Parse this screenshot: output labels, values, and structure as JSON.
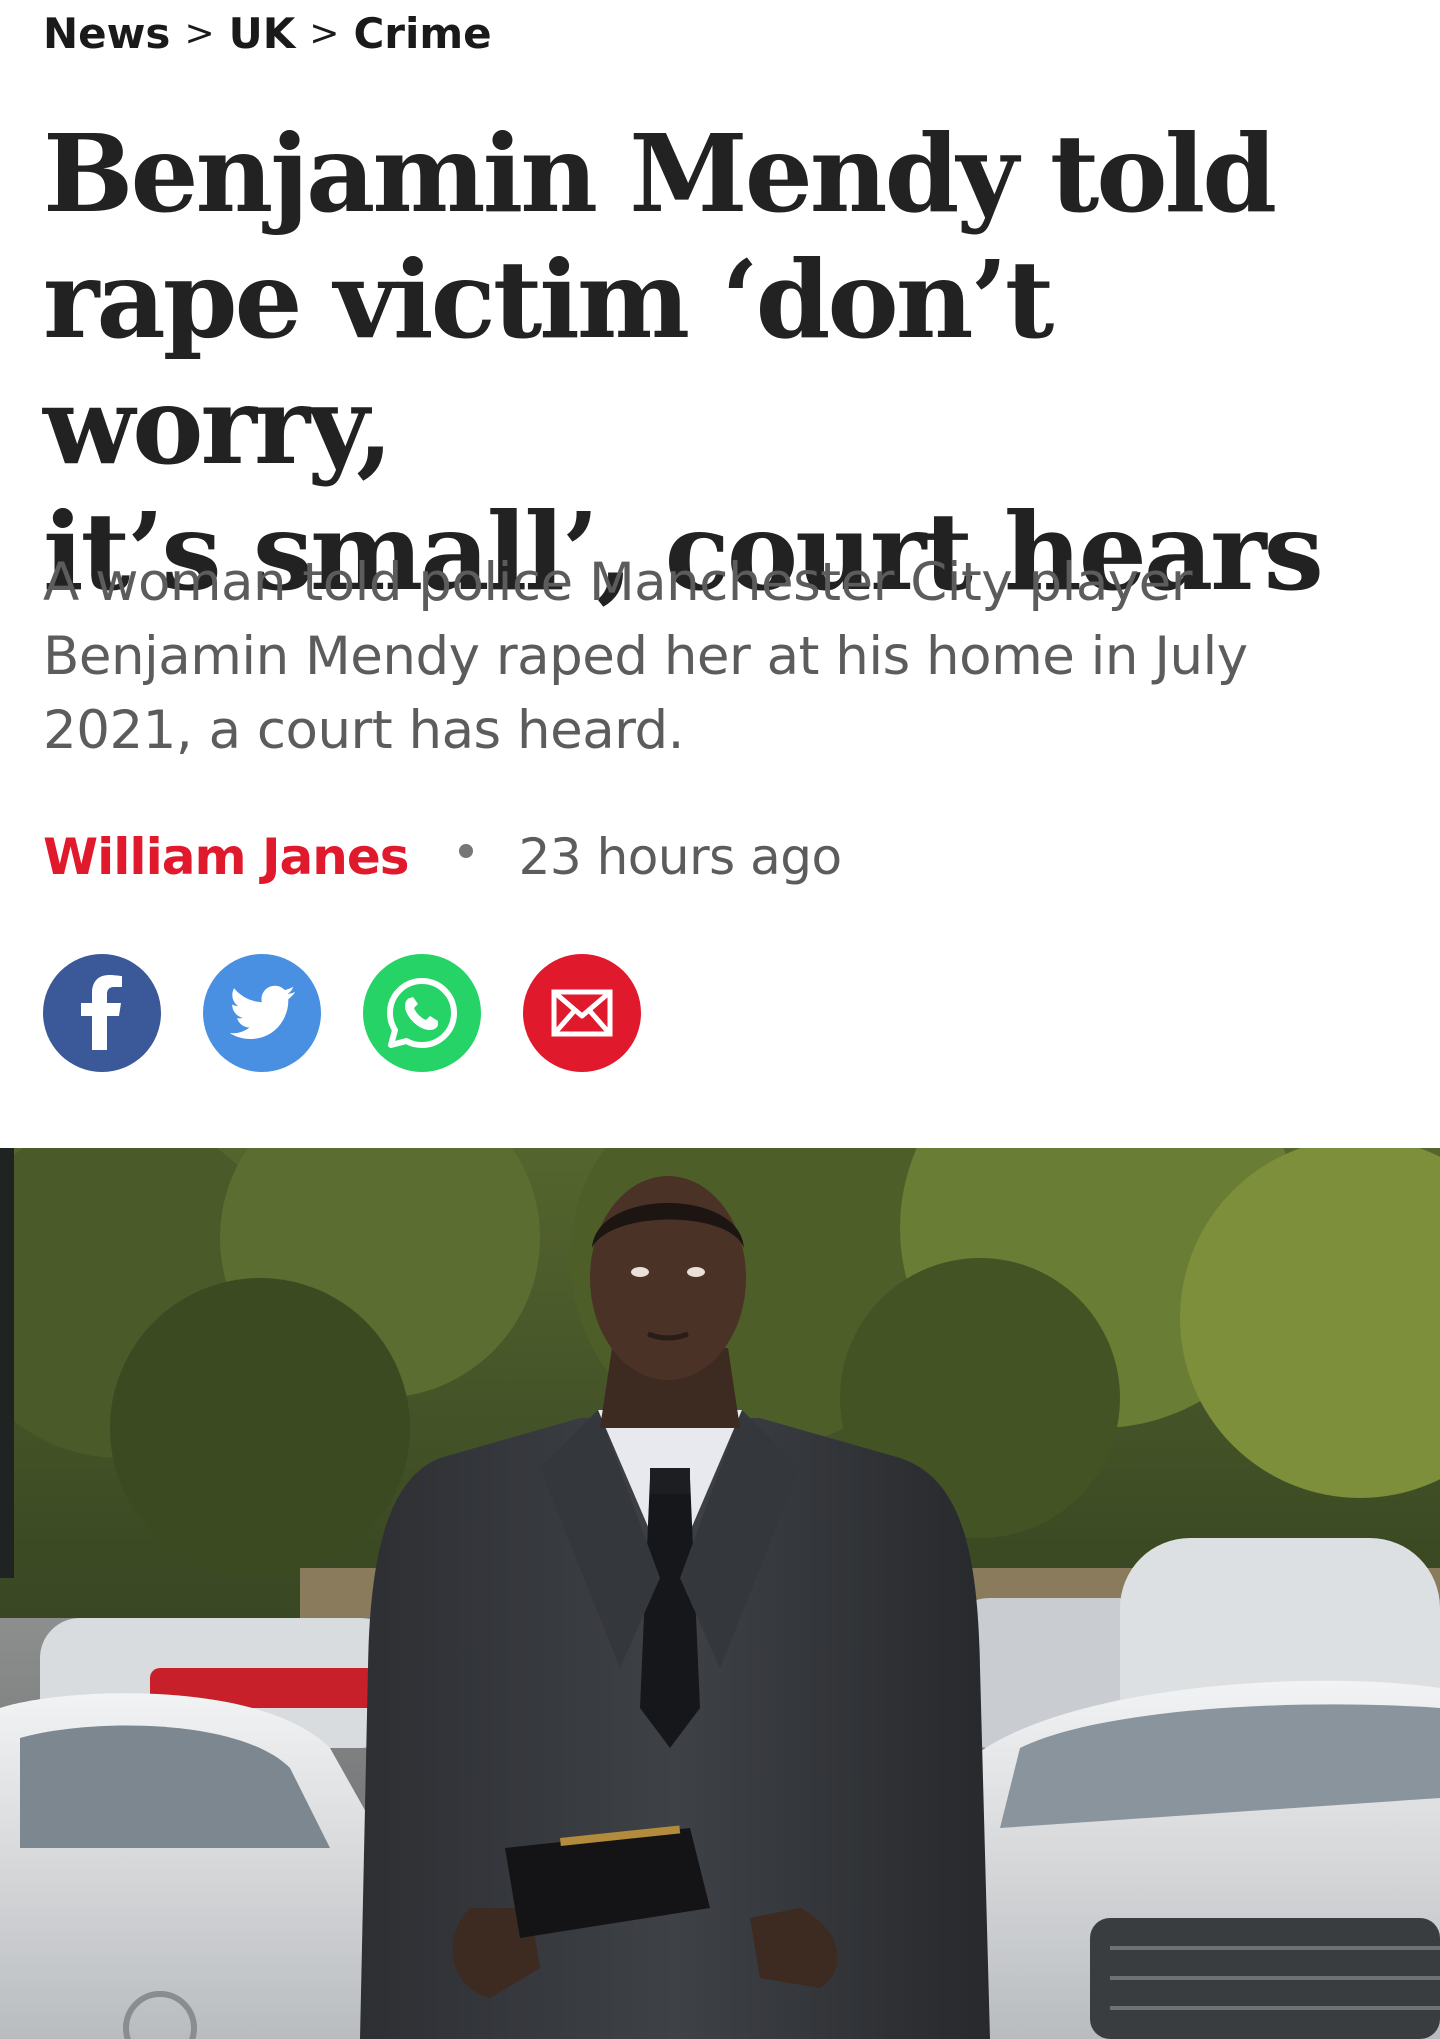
{
  "breadcrumb": {
    "items": [
      "News",
      "UK",
      "Crime"
    ],
    "separator": ">"
  },
  "article": {
    "headline_lines": [
      "Benjamin Mendy told",
      "rape victim ‘don’t worry,",
      "it’s small’, court hears"
    ],
    "standfirst": "A woman told police Manchester City player Benjamin Mendy raped her at his home in July 2021, a court has heard.",
    "author": "William Janes",
    "time_ago": "23 hours ago"
  },
  "share": [
    {
      "icon": "facebook-icon",
      "color": "#3b5998"
    },
    {
      "icon": "twitter-icon",
      "color": "#4a90e2"
    },
    {
      "icon": "whatsapp-icon",
      "color": "#25d366"
    },
    {
      "icon": "email-icon",
      "color": "#e1192d"
    }
  ],
  "colors": {
    "accent": "#e1192d",
    "headline": "#222222",
    "standfirst": "#5c5c5c"
  }
}
